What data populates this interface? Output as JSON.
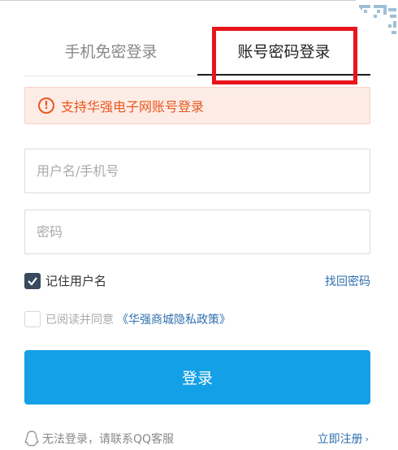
{
  "tabs": [
    {
      "label": "手机免密登录",
      "active": false
    },
    {
      "label": "账号密码登录",
      "active": true
    }
  ],
  "notice": {
    "text": "支持华强电子网账号登录",
    "icon": "exclamation-circle-icon",
    "color": "#e9581f"
  },
  "form": {
    "username_placeholder": "用户名/手机号",
    "password_placeholder": "密码",
    "remember_label": "记住用户名",
    "remember_checked": true,
    "forgot_label": "找回密码",
    "agree_label": "已阅读并同意",
    "policy_label": "《华强商城隐私政策》",
    "agree_checked": false,
    "login_label": "登录"
  },
  "footer": {
    "help_text": "无法登录，请联系QQ客服",
    "register_label": "立即注册"
  },
  "colors": {
    "accent": "#14a0e6",
    "link": "#2f6fae",
    "highlight": "#e8151b"
  }
}
